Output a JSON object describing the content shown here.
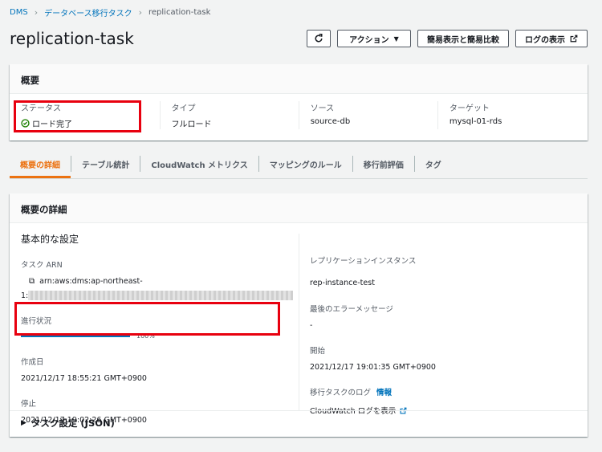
{
  "breadcrumb": {
    "items": [
      "DMS",
      "データベース移行タスク",
      "replication-task"
    ]
  },
  "page_title": "replication-task",
  "toolbar": {
    "refresh_icon": "refresh-icon",
    "actions_label": "アクション",
    "compare_label": "簡易表示と簡易比較",
    "logs_label": "ログの表示"
  },
  "summary": {
    "title": "概要",
    "status": {
      "label": "ステータス",
      "value": "ロード完了"
    },
    "type": {
      "label": "タイプ",
      "value": "フルロード"
    },
    "source": {
      "label": "ソース",
      "value": "source-db"
    },
    "target": {
      "label": "ターゲット",
      "value": "mysql-01-rds"
    }
  },
  "tabs": [
    "概要の詳細",
    "テーブル統計",
    "CloudWatch メトリクス",
    "マッピングのルール",
    "移行前評価",
    "タグ"
  ],
  "details": {
    "title": "概要の詳細",
    "section_title": "基本的な設定",
    "task_arn": {
      "label": "タスク ARN",
      "value_line1": "arn:aws:dms:ap-northeast-",
      "value_line2_prefix": "1:"
    },
    "progress": {
      "label": "進行状況",
      "value": 100,
      "value_text": "100%"
    },
    "created": {
      "label": "作成日",
      "value": "2021/12/17 18:55:21 GMT+0900"
    },
    "stopped": {
      "label": "停止",
      "value": "2021/12/17 19:02:26 GMT+0900"
    },
    "replication_instance": {
      "label": "レプリケーションインスタンス",
      "value": "rep-instance-test"
    },
    "last_error": {
      "label": "最後のエラーメッセージ",
      "value": "-"
    },
    "started": {
      "label": "開始",
      "value": "2021/12/17 19:01:35 GMT+0900"
    },
    "task_log": {
      "label": "移行タスクのログ",
      "info": "情報",
      "link": "CloudWatch ログを表示"
    },
    "expander": "タスク設定 (JSON)"
  },
  "colors": {
    "link": "#0073bb",
    "success": "#1d8102",
    "accent": "#ec7211",
    "highlight": "#e8000f"
  }
}
